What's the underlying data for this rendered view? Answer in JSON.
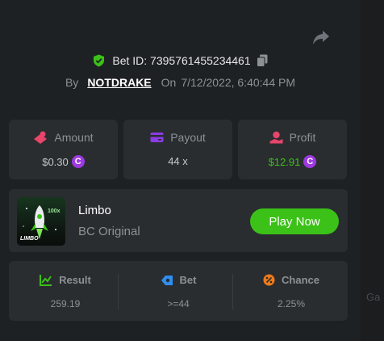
{
  "header": {
    "bet_id_label": "Bet ID:",
    "bet_id": "7395761455234461",
    "by_label": "By",
    "username": "NOTDRAKE",
    "on_label": "On",
    "datetime": "7/12/2022, 6:40:44 PM"
  },
  "stats": {
    "amount": {
      "label": "Amount",
      "value": "$0.30",
      "coin": "C"
    },
    "payout": {
      "label": "Payout",
      "value": "44 x"
    },
    "profit": {
      "label": "Profit",
      "value": "$12.91",
      "coin": "C"
    }
  },
  "game": {
    "name": "Limbo",
    "subtitle": "BC Original",
    "thumb_text": "LIMBO",
    "thumb_badge": "100x",
    "play_label": "Play Now"
  },
  "result": {
    "result": {
      "label": "Result",
      "value": "259.19"
    },
    "bet": {
      "label": "Bet",
      "value": ">=44"
    },
    "chance": {
      "label": "Chance",
      "value": "2.25%"
    }
  },
  "background_peek": "Ga",
  "colors": {
    "panel": "#1e2124",
    "card": "#2a2d30",
    "accent_green": "#3bc117",
    "profit_green": "#3bc117",
    "coin_purple": "#9d3ae0",
    "muted_text": "#8c9196"
  },
  "icons": [
    "share-icon",
    "shield-check-icon",
    "copy-icon",
    "amount-icon",
    "payout-icon",
    "profit-icon",
    "result-icon",
    "bet-icon",
    "chance-icon",
    "coin-icon"
  ]
}
